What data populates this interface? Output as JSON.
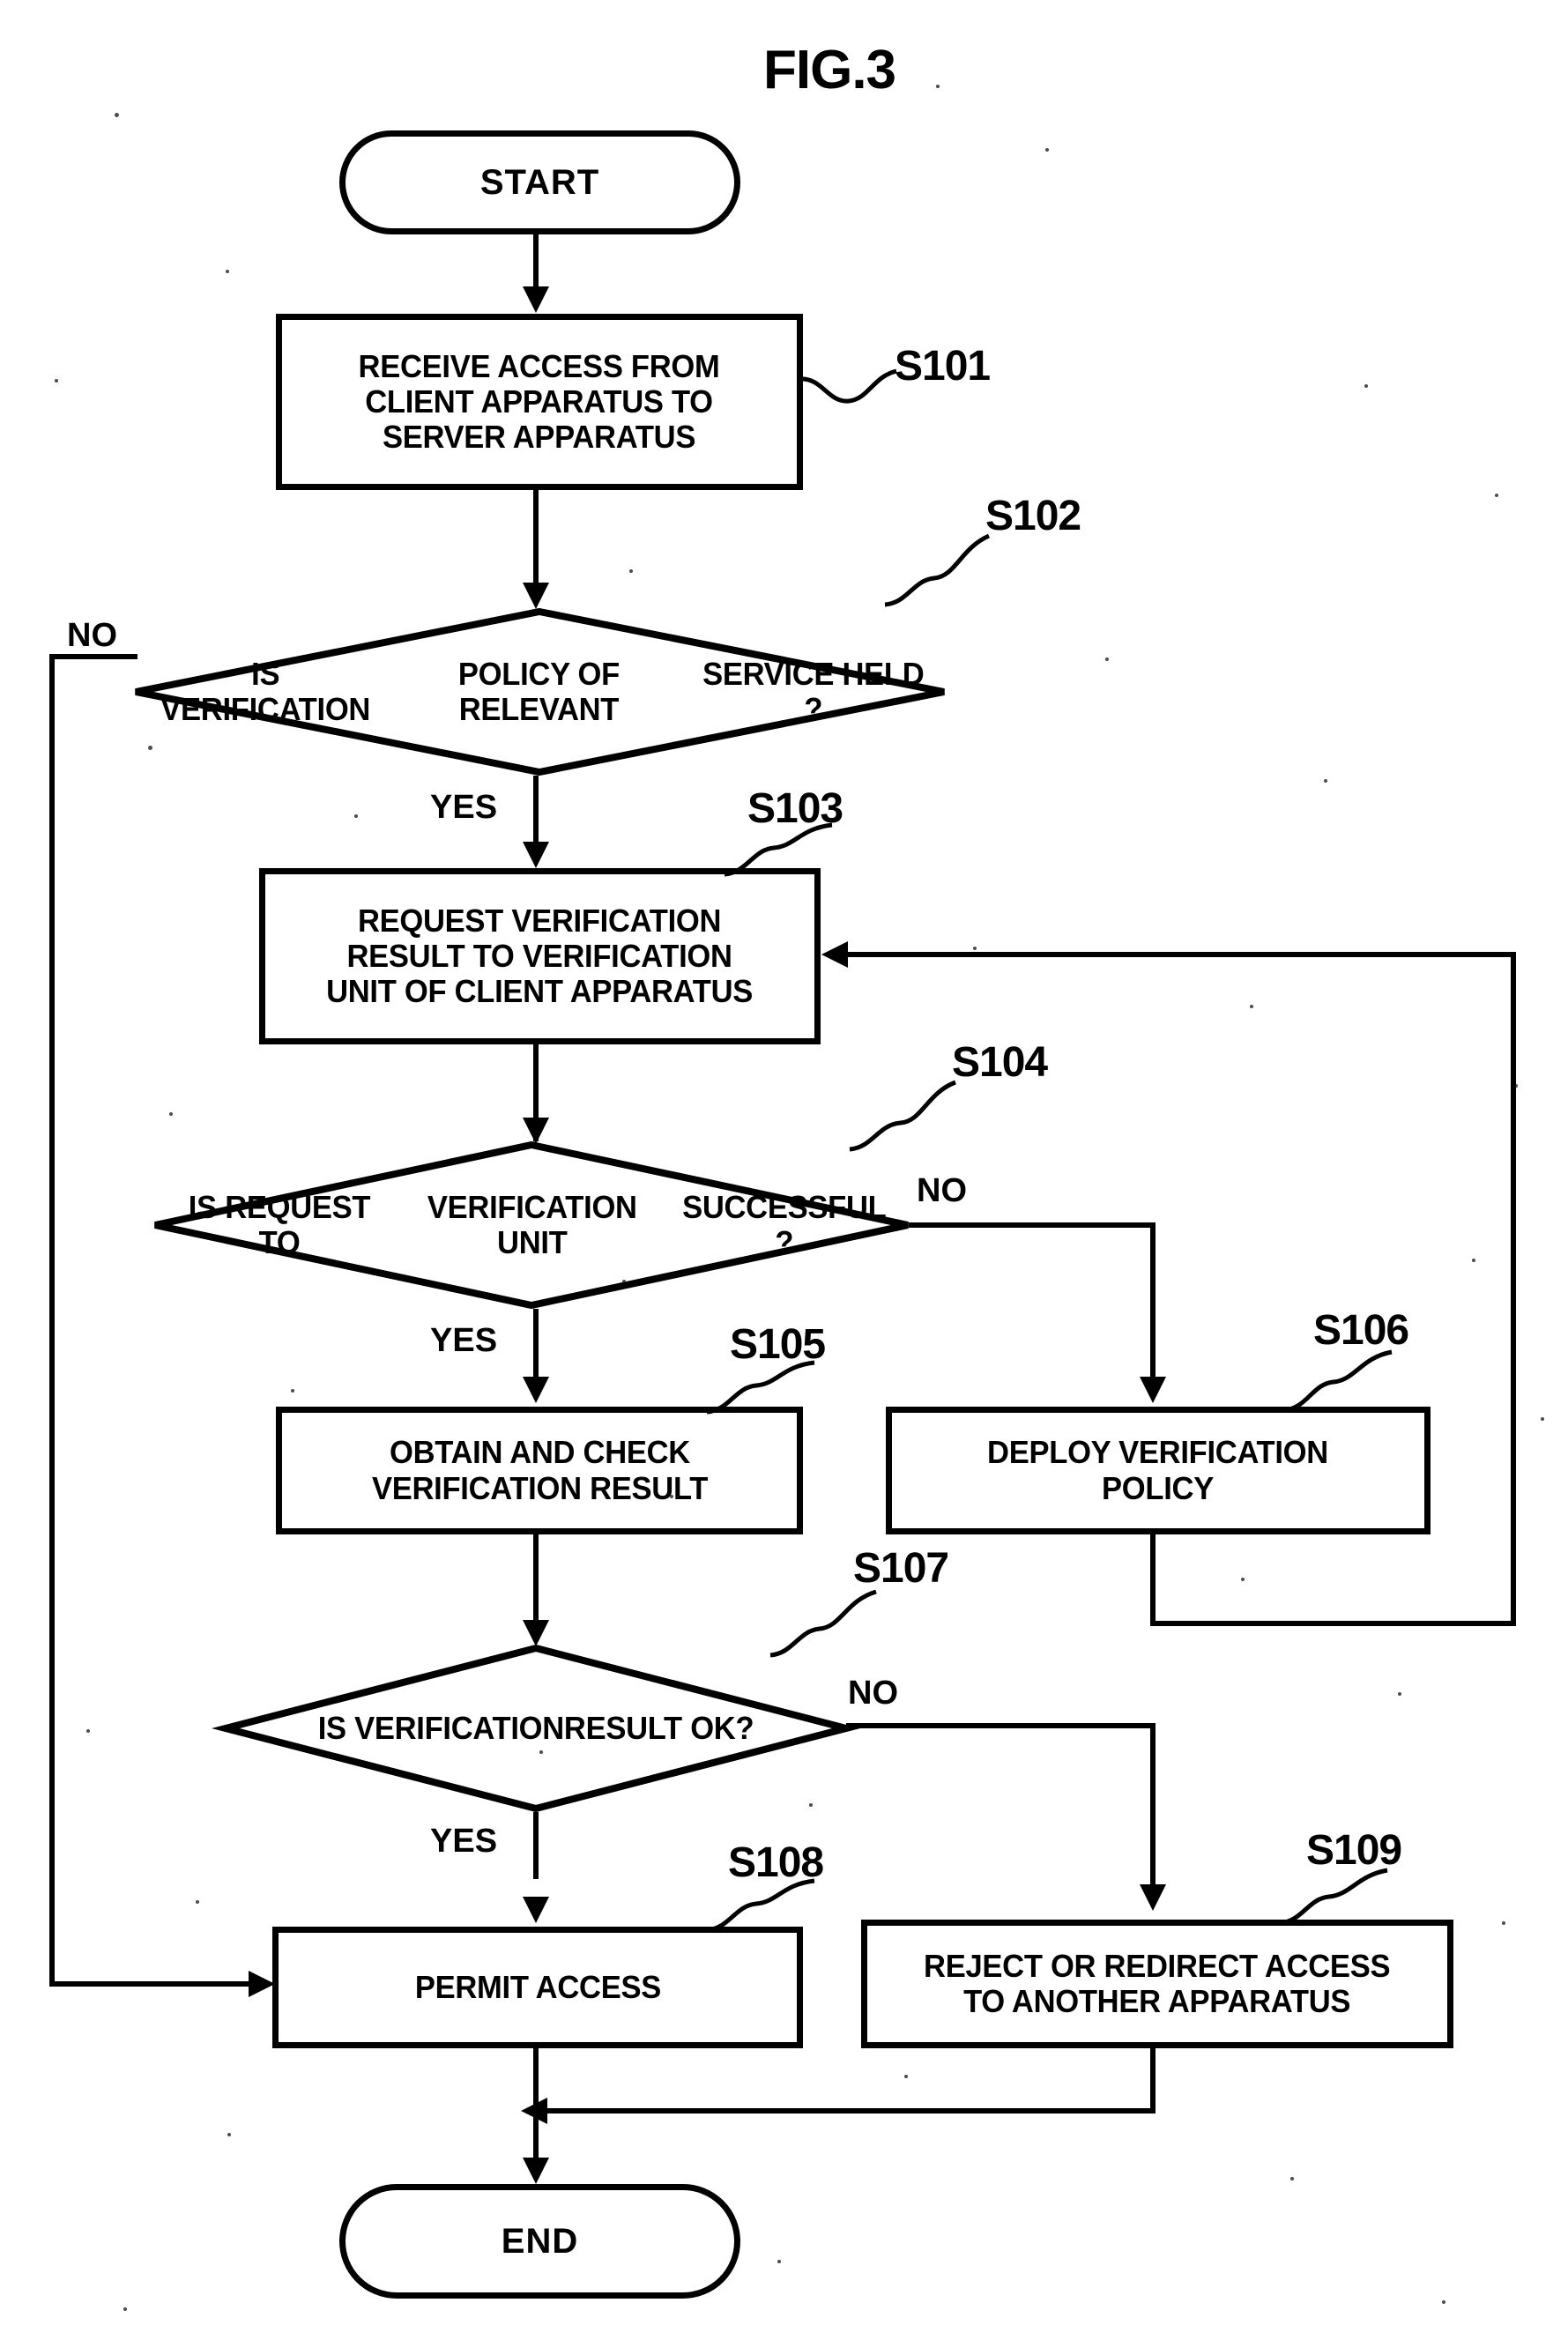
{
  "figure": {
    "title": "FIG.3",
    "type": "flowchart",
    "ink_color": "#000000",
    "background_color": "#ffffff"
  },
  "nodes": {
    "start": {
      "id": "start",
      "shape": "terminator",
      "label": "START"
    },
    "s101": {
      "id": "S101",
      "shape": "process",
      "ref": "S101",
      "lines": [
        "RECEIVE ACCESS FROM",
        "CLIENT APPARATUS TO",
        "SERVER APPARATUS"
      ]
    },
    "s102": {
      "id": "S102",
      "shape": "decision",
      "ref": "S102",
      "lines": [
        "IS VERIFICATION",
        "POLICY OF RELEVANT",
        "SERVICE HELD ?"
      ],
      "yes_label": "YES",
      "no_label": "NO"
    },
    "s103": {
      "id": "S103",
      "shape": "process",
      "ref": "S103",
      "lines": [
        "REQUEST VERIFICATION",
        "RESULT TO VERIFICATION",
        "UNIT OF CLIENT APPARATUS"
      ]
    },
    "s104": {
      "id": "S104",
      "shape": "decision",
      "ref": "S104",
      "lines": [
        "IS REQUEST TO",
        "VERIFICATION UNIT",
        "SUCCESSFUL ?"
      ],
      "yes_label": "YES",
      "no_label": "NO"
    },
    "s105": {
      "id": "S105",
      "shape": "process",
      "ref": "S105",
      "lines": [
        "OBTAIN AND CHECK",
        "VERIFICATION RESULT"
      ]
    },
    "s106": {
      "id": "S106",
      "shape": "process",
      "ref": "S106",
      "lines": [
        "DEPLOY VERIFICATION",
        "POLICY"
      ]
    },
    "s107": {
      "id": "S107",
      "shape": "decision",
      "ref": "S107",
      "lines": [
        "IS VERIFICATION",
        "RESULT OK?"
      ],
      "yes_label": "YES",
      "no_label": "NO"
    },
    "s108": {
      "id": "S108",
      "shape": "process",
      "ref": "S108",
      "lines": [
        "PERMIT ACCESS"
      ]
    },
    "s109": {
      "id": "S109",
      "shape": "process",
      "ref": "S109",
      "lines": [
        "REJECT OR REDIRECT ACCESS",
        "TO ANOTHER APPARATUS"
      ]
    },
    "end": {
      "id": "end",
      "shape": "terminator",
      "label": "END"
    }
  },
  "edges": [
    {
      "from": "start",
      "to": "s101",
      "label": ""
    },
    {
      "from": "s101",
      "to": "s102",
      "label": ""
    },
    {
      "from": "s102",
      "to": "s103",
      "label": "YES"
    },
    {
      "from": "s102",
      "to": "s108",
      "label": "NO"
    },
    {
      "from": "s103",
      "to": "s104",
      "label": ""
    },
    {
      "from": "s104",
      "to": "s105",
      "label": "YES"
    },
    {
      "from": "s104",
      "to": "s106",
      "label": "NO"
    },
    {
      "from": "s105",
      "to": "s107",
      "label": ""
    },
    {
      "from": "s106",
      "to": "s103",
      "label": ""
    },
    {
      "from": "s107",
      "to": "s108",
      "label": "YES"
    },
    {
      "from": "s107",
      "to": "s109",
      "label": "NO"
    },
    {
      "from": "s108",
      "to": "end",
      "label": ""
    },
    {
      "from": "s109",
      "to": "end",
      "label": ""
    }
  ]
}
